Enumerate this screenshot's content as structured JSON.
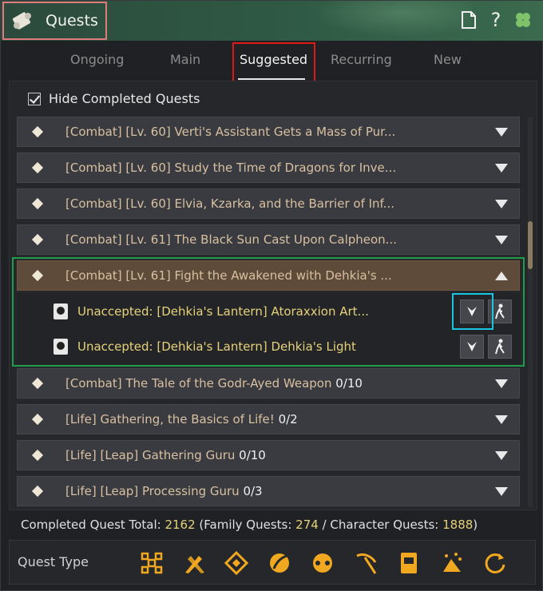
{
  "window": {
    "title": "Quests",
    "title_icon": "scroll-icon",
    "toolbar_icons": [
      "document-icon",
      "help-icon",
      "clover-icon"
    ],
    "help_glyph": "?"
  },
  "tabs": [
    {
      "label": "Ongoing",
      "active": false
    },
    {
      "label": "Main",
      "active": false
    },
    {
      "label": "Suggested",
      "active": true
    },
    {
      "label": "Recurring",
      "active": false
    },
    {
      "label": "New",
      "active": false
    }
  ],
  "filter": {
    "hide_completed_label": "Hide Completed Quests",
    "checked": true
  },
  "quests": [
    {
      "text": "[Combat] [Lv. 60] Verti's Assistant Gets a Mass of Pur...",
      "count": ""
    },
    {
      "text": "[Combat] [Lv. 60] Study the Time of Dragons for Inve...",
      "count": ""
    },
    {
      "text": "[Combat] [Lv. 60] Elvia, Kzarka, and the Barrier of Inf...",
      "count": ""
    },
    {
      "text": "[Combat] [Lv. 61] The Black Sun Cast Upon Calpheon...",
      "count": ""
    },
    {
      "text": "[Combat] [Lv. 61] Fight the Awakened with Dehkia's ...",
      "count": "",
      "expanded": true
    },
    {
      "text": "[Combat] The Tale of the Godr-Ayed Weapon ",
      "count": "0/10"
    },
    {
      "text": "[Life] Gathering, the Basics of Life! ",
      "count": "0/2"
    },
    {
      "text": "[Life] [Leap] Gathering Guru ",
      "count": "0/10"
    },
    {
      "text": "[Life] [Leap] Processing Guru ",
      "count": "0/3"
    }
  ],
  "sub_quests": [
    {
      "text": "Unaccepted: [Dehkia's Lantern] Atoraxxion Art..."
    },
    {
      "text": "Unaccepted: [Dehkia's Lantern] Dehkia's Light"
    }
  ],
  "totals": {
    "label": "Completed Quest Total: ",
    "total": "2162",
    "family_label": " (Family Quests: ",
    "family": "274",
    "sep": " / ",
    "character_label": "Character Quests: ",
    "character": "1888",
    "close": ")"
  },
  "quest_type": {
    "label": "Quest Type",
    "icons": [
      "all-types-icon",
      "combat-icon",
      "navigation-icon",
      "leaf-life-icon",
      "trade-icon",
      "pickaxe-icon",
      "book-icon",
      "party-icon",
      "refresh-icon"
    ]
  },
  "colors": {
    "accent": "#e6d27a",
    "quest_text": "#d8c0a0",
    "icon_orange": "#f0a820"
  }
}
